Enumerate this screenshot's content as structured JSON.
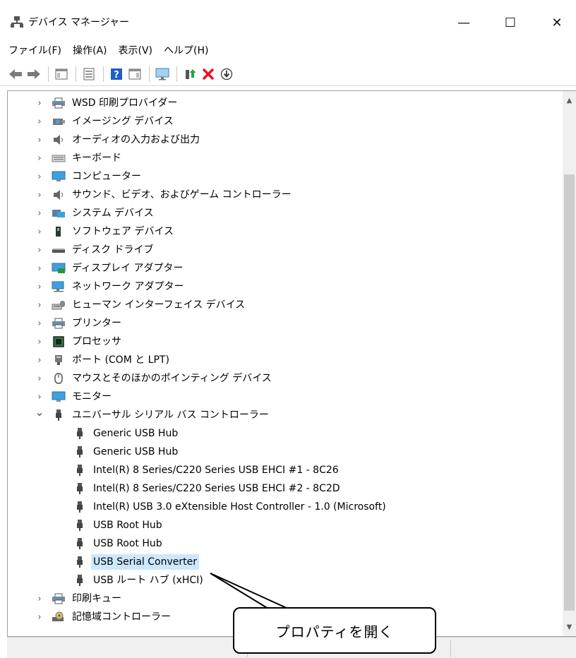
{
  "window": {
    "title": "デバイス マネージャー",
    "minimize": "—",
    "maximize": "☐",
    "close": "✕"
  },
  "menu": [
    "ファイル(F)",
    "操作(A)",
    "表示(V)",
    "ヘルプ(H)"
  ],
  "tree_top": [
    {
      "label": "WSD 印刷プロバイダー",
      "icon": "printer-icon"
    },
    {
      "label": "イメージング デバイス",
      "icon": "camera-icon"
    },
    {
      "label": "オーディオの入力および出力",
      "icon": "speaker-icon"
    },
    {
      "label": "キーボード",
      "icon": "keyboard-icon"
    },
    {
      "label": "コンピューター",
      "icon": "monitor-icon"
    },
    {
      "label": "サウンド、ビデオ、およびゲーム コントローラー",
      "icon": "speaker-icon"
    },
    {
      "label": "システム デバイス",
      "icon": "folder-icon"
    },
    {
      "label": "ソフトウェア デバイス",
      "icon": "device-icon"
    },
    {
      "label": "ディスク ドライブ",
      "icon": "disk-icon"
    },
    {
      "label": "ディスプレイ アダプター",
      "icon": "display-adapter-icon"
    },
    {
      "label": "ネットワーク アダプター",
      "icon": "network-icon"
    },
    {
      "label": "ヒューマン インターフェイス デバイス",
      "icon": "hid-icon"
    },
    {
      "label": "プリンター",
      "icon": "printer-icon"
    },
    {
      "label": "プロセッサ",
      "icon": "cpu-icon"
    },
    {
      "label": "ポート (COM と LPT)",
      "icon": "port-icon"
    },
    {
      "label": "マウスとそのほかのポインティング デバイス",
      "icon": "mouse-icon"
    },
    {
      "label": "モニター",
      "icon": "monitor-icon"
    },
    {
      "label": "ユニバーサル シリアル バス コントローラー",
      "icon": "usb-icon",
      "expanded": true
    }
  ],
  "usb_children": [
    "Generic USB Hub",
    "Generic USB Hub",
    "Intel(R) 8 Series/C220 Series USB EHCI #1 - 8C26",
    "Intel(R) 8 Series/C220 Series USB EHCI #2 - 8C2D",
    "Intel(R) USB 3.0 eXtensible Host Controller - 1.0 (Microsoft)",
    "USB Root Hub",
    "USB Root Hub",
    "USB Serial Converter",
    "USB ルート ハブ (xHCI)"
  ],
  "selected_child": "USB Serial Converter",
  "tree_bottom": [
    {
      "label": "印刷キュー",
      "icon": "printer-icon"
    },
    {
      "label": "記憶域コントローラー",
      "icon": "storage-icon"
    }
  ],
  "callout": {
    "text": "プロパティを開く"
  },
  "colors": {
    "selection": "#cce8ff",
    "delete_red": "#e81123",
    "help_blue": "#1e5fc8"
  }
}
